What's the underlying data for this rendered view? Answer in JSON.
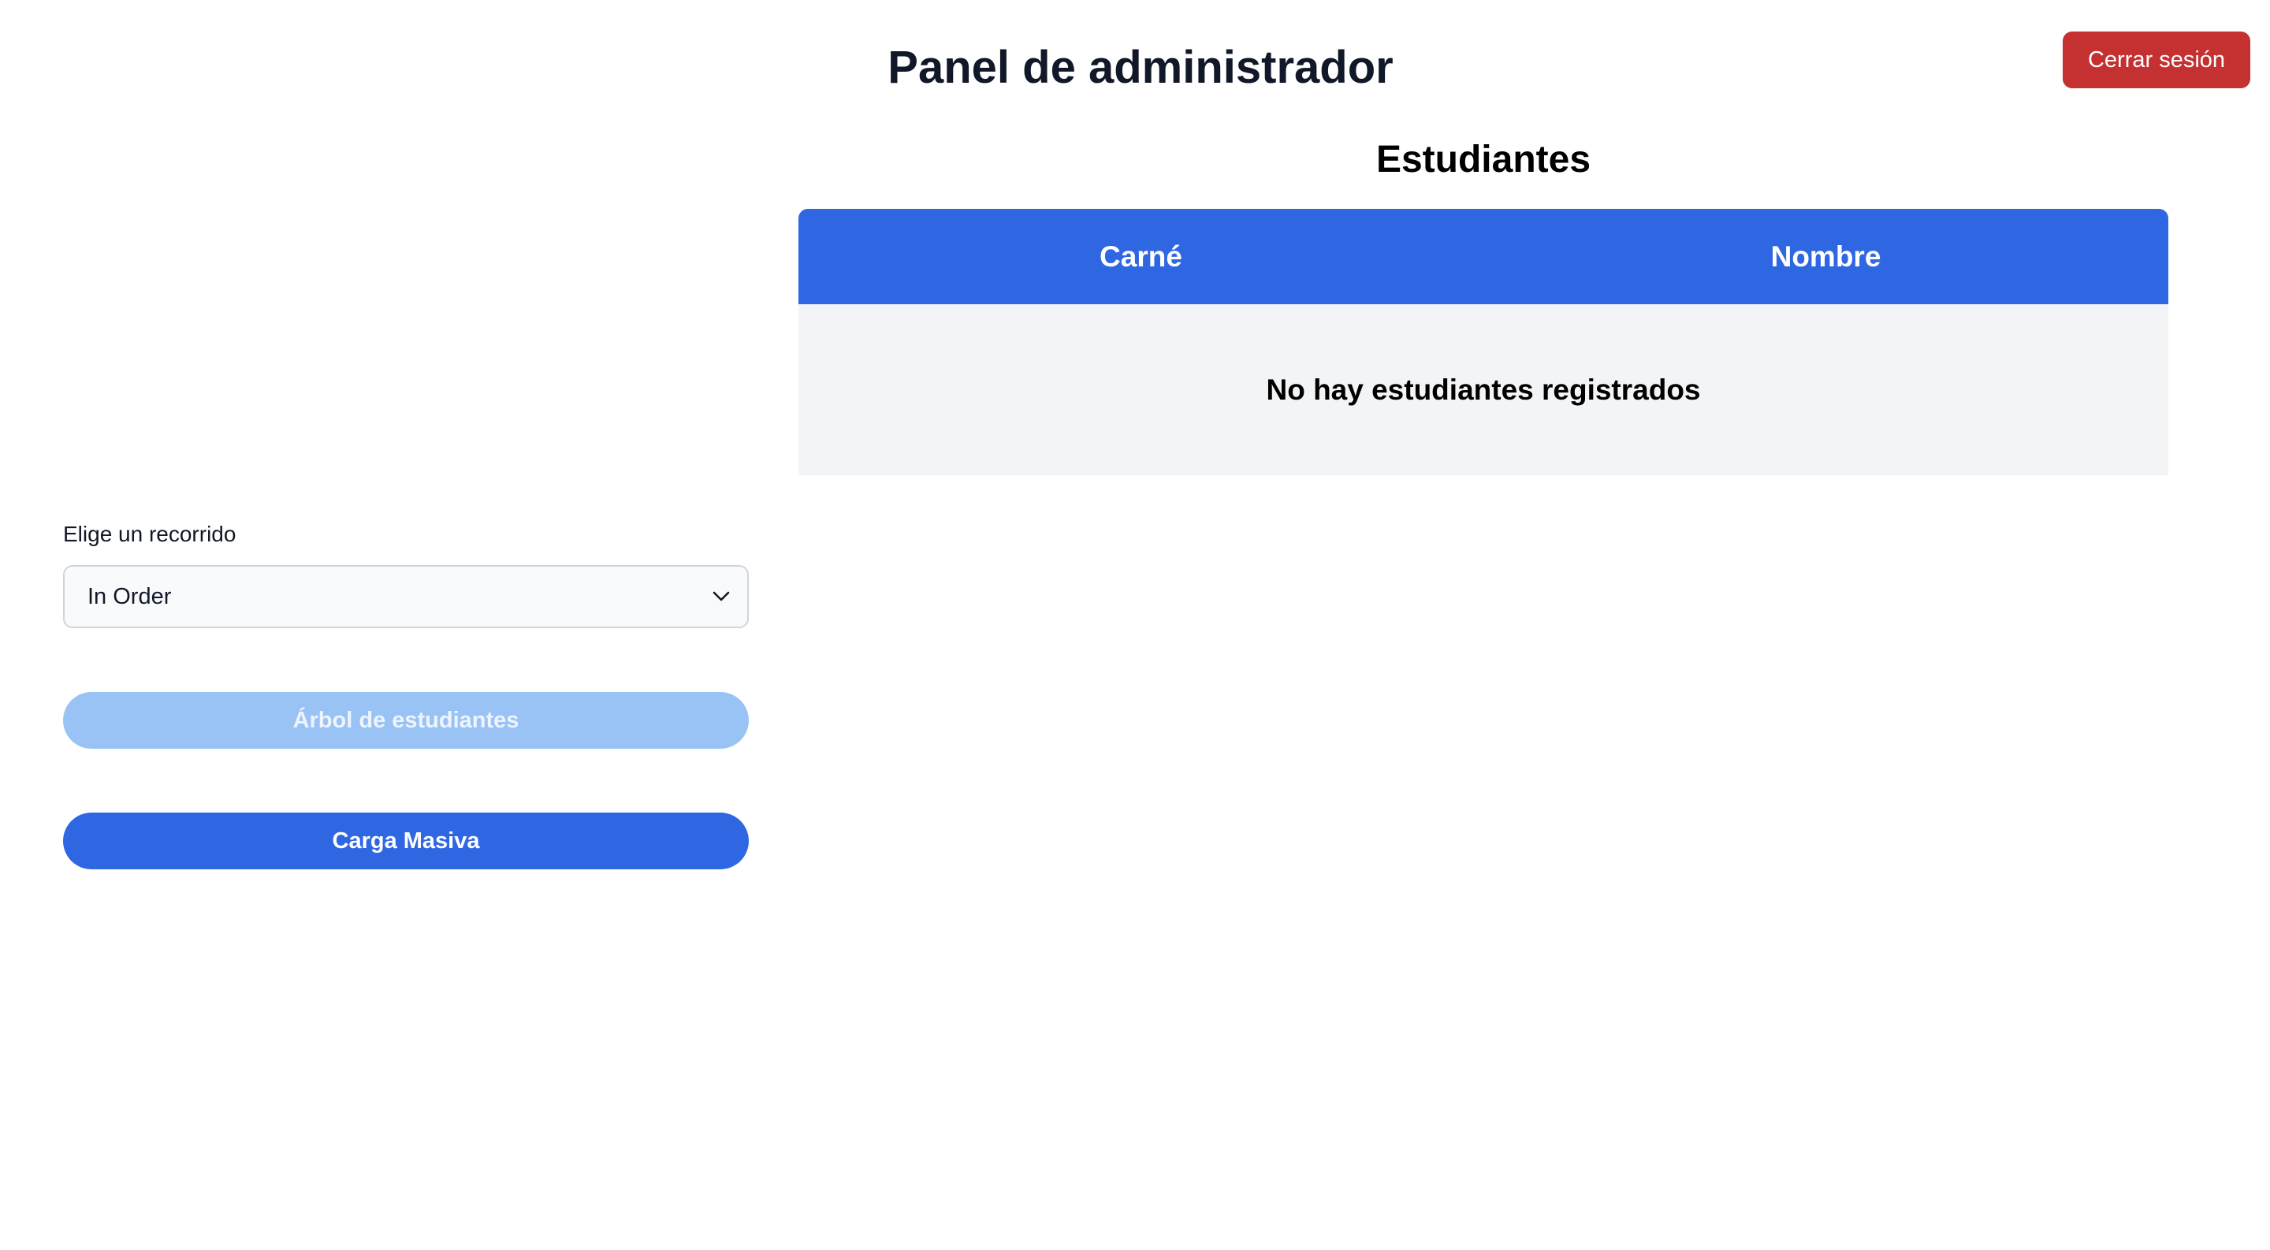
{
  "header": {
    "title": "Panel de administrador",
    "logout_label": "Cerrar sesión",
    "logout_color": "#c53030"
  },
  "students": {
    "title": "Estudiantes",
    "columns": [
      "Carné",
      "Nombre"
    ],
    "empty_message": "No hay estudiantes registrados",
    "header_color": "#2f67e3"
  },
  "traversal": {
    "label": "Elige un recorrido",
    "selected": "In Order",
    "icon": "chevron-down-icon"
  },
  "actions": {
    "tree_label": "Árbol de estudiantes",
    "tree_disabled": true,
    "upload_label": "Carga Masiva",
    "primary_color": "#2f67e3"
  }
}
